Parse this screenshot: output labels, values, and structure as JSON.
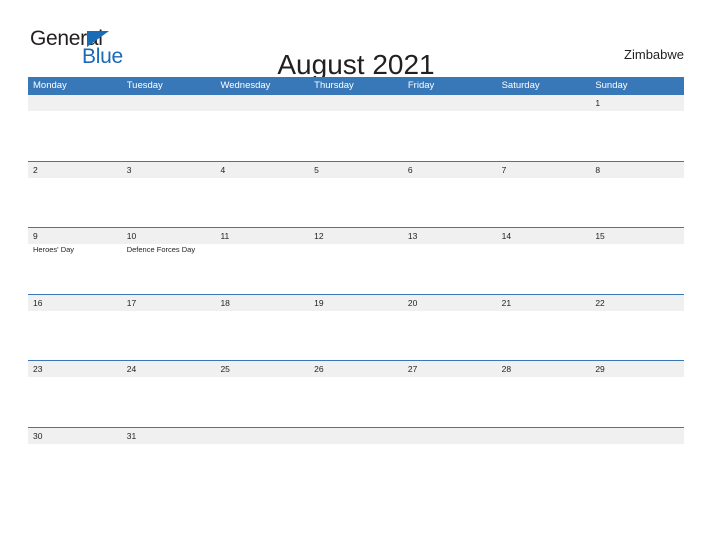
{
  "header": {
    "logo": {
      "word_one": "General",
      "word_two": "Blue",
      "triangle_icon": "triangle-icon"
    },
    "title": "August 2021",
    "country": "Zimbabwe"
  },
  "calendar": {
    "weekdays": [
      "Monday",
      "Tuesday",
      "Wednesday",
      "Thursday",
      "Friday",
      "Saturday",
      "Sunday"
    ],
    "accent_color": "#3878b8",
    "band_color": "#f0f0f0",
    "weeks": [
      [
        {
          "date": "",
          "event": ""
        },
        {
          "date": "",
          "event": ""
        },
        {
          "date": "",
          "event": ""
        },
        {
          "date": "",
          "event": ""
        },
        {
          "date": "",
          "event": ""
        },
        {
          "date": "",
          "event": ""
        },
        {
          "date": "1",
          "event": ""
        }
      ],
      [
        {
          "date": "2",
          "event": ""
        },
        {
          "date": "3",
          "event": ""
        },
        {
          "date": "4",
          "event": ""
        },
        {
          "date": "5",
          "event": ""
        },
        {
          "date": "6",
          "event": ""
        },
        {
          "date": "7",
          "event": ""
        },
        {
          "date": "8",
          "event": ""
        }
      ],
      [
        {
          "date": "9",
          "event": "Heroes' Day"
        },
        {
          "date": "10",
          "event": "Defence Forces Day"
        },
        {
          "date": "11",
          "event": ""
        },
        {
          "date": "12",
          "event": ""
        },
        {
          "date": "13",
          "event": ""
        },
        {
          "date": "14",
          "event": ""
        },
        {
          "date": "15",
          "event": ""
        }
      ],
      [
        {
          "date": "16",
          "event": ""
        },
        {
          "date": "17",
          "event": ""
        },
        {
          "date": "18",
          "event": ""
        },
        {
          "date": "19",
          "event": ""
        },
        {
          "date": "20",
          "event": ""
        },
        {
          "date": "21",
          "event": ""
        },
        {
          "date": "22",
          "event": ""
        }
      ],
      [
        {
          "date": "23",
          "event": ""
        },
        {
          "date": "24",
          "event": ""
        },
        {
          "date": "25",
          "event": ""
        },
        {
          "date": "26",
          "event": ""
        },
        {
          "date": "27",
          "event": ""
        },
        {
          "date": "28",
          "event": ""
        },
        {
          "date": "29",
          "event": ""
        }
      ],
      [
        {
          "date": "30",
          "event": ""
        },
        {
          "date": "31",
          "event": ""
        },
        {
          "date": "",
          "event": ""
        },
        {
          "date": "",
          "event": ""
        },
        {
          "date": "",
          "event": ""
        },
        {
          "date": "",
          "event": ""
        },
        {
          "date": "",
          "event": ""
        }
      ]
    ]
  }
}
